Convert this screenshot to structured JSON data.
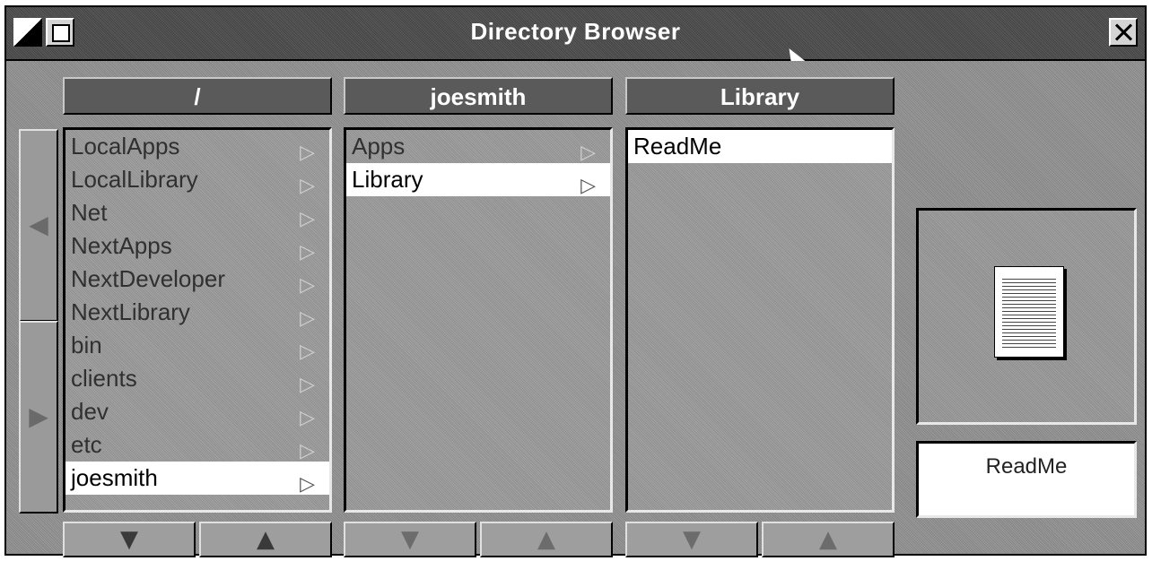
{
  "window": {
    "title": "Directory Browser"
  },
  "columns": [
    {
      "header": "/",
      "items": [
        {
          "label": "LocalApps",
          "selected": false
        },
        {
          "label": "LocalLibrary",
          "selected": false
        },
        {
          "label": "Net",
          "selected": false
        },
        {
          "label": "NextApps",
          "selected": false
        },
        {
          "label": "NextDeveloper",
          "selected": false
        },
        {
          "label": "NextLibrary",
          "selected": false
        },
        {
          "label": "bin",
          "selected": false
        },
        {
          "label": "clients",
          "selected": false
        },
        {
          "label": "dev",
          "selected": false
        },
        {
          "label": "etc",
          "selected": false
        },
        {
          "label": "joesmith",
          "selected": true
        }
      ]
    },
    {
      "header": "joesmith",
      "items": [
        {
          "label": "Apps",
          "selected": false
        },
        {
          "label": "Library",
          "selected": true
        }
      ]
    },
    {
      "header": "Library",
      "items": [
        {
          "label": "ReadMe",
          "selected": true,
          "leaf": true
        }
      ]
    }
  ],
  "glyphs": {
    "branch": "▷",
    "scroll_down": "▼",
    "scroll_up": "▲",
    "scroll_left": "◀",
    "scroll_right": "▶"
  },
  "preview": {
    "filename": "ReadMe",
    "icon": "document-icon"
  }
}
